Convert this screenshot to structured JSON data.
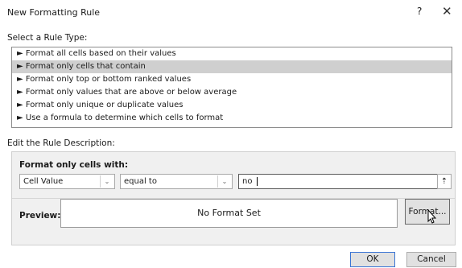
{
  "window": {
    "title": "New Formatting Rule",
    "help_label": "?",
    "close_label": "✕"
  },
  "rule_type": {
    "label": "Select a Rule Type:",
    "items": [
      "► Format all cells based on their values",
      "► Format only cells that contain",
      "► Format only top or bottom ranked values",
      "► Format only values that are above or below average",
      "► Format only unique or duplicate values",
      "► Use a formula to determine which cells to format"
    ],
    "selected_index": 1
  },
  "description": {
    "label": "Edit the Rule Description:",
    "format_only_label": "Format only cells with:",
    "condition_type": "Cell Value",
    "operator": "equal to",
    "value": "no",
    "ref_button": "⇡",
    "preview_label": "Preview:",
    "preview_text": "No Format Set",
    "format_button": "Format..."
  },
  "buttons": {
    "ok": "OK",
    "cancel": "Cancel"
  },
  "icons": {
    "dropdown": "chevron-down-icon",
    "cursor": "mouse-pointer-icon"
  }
}
